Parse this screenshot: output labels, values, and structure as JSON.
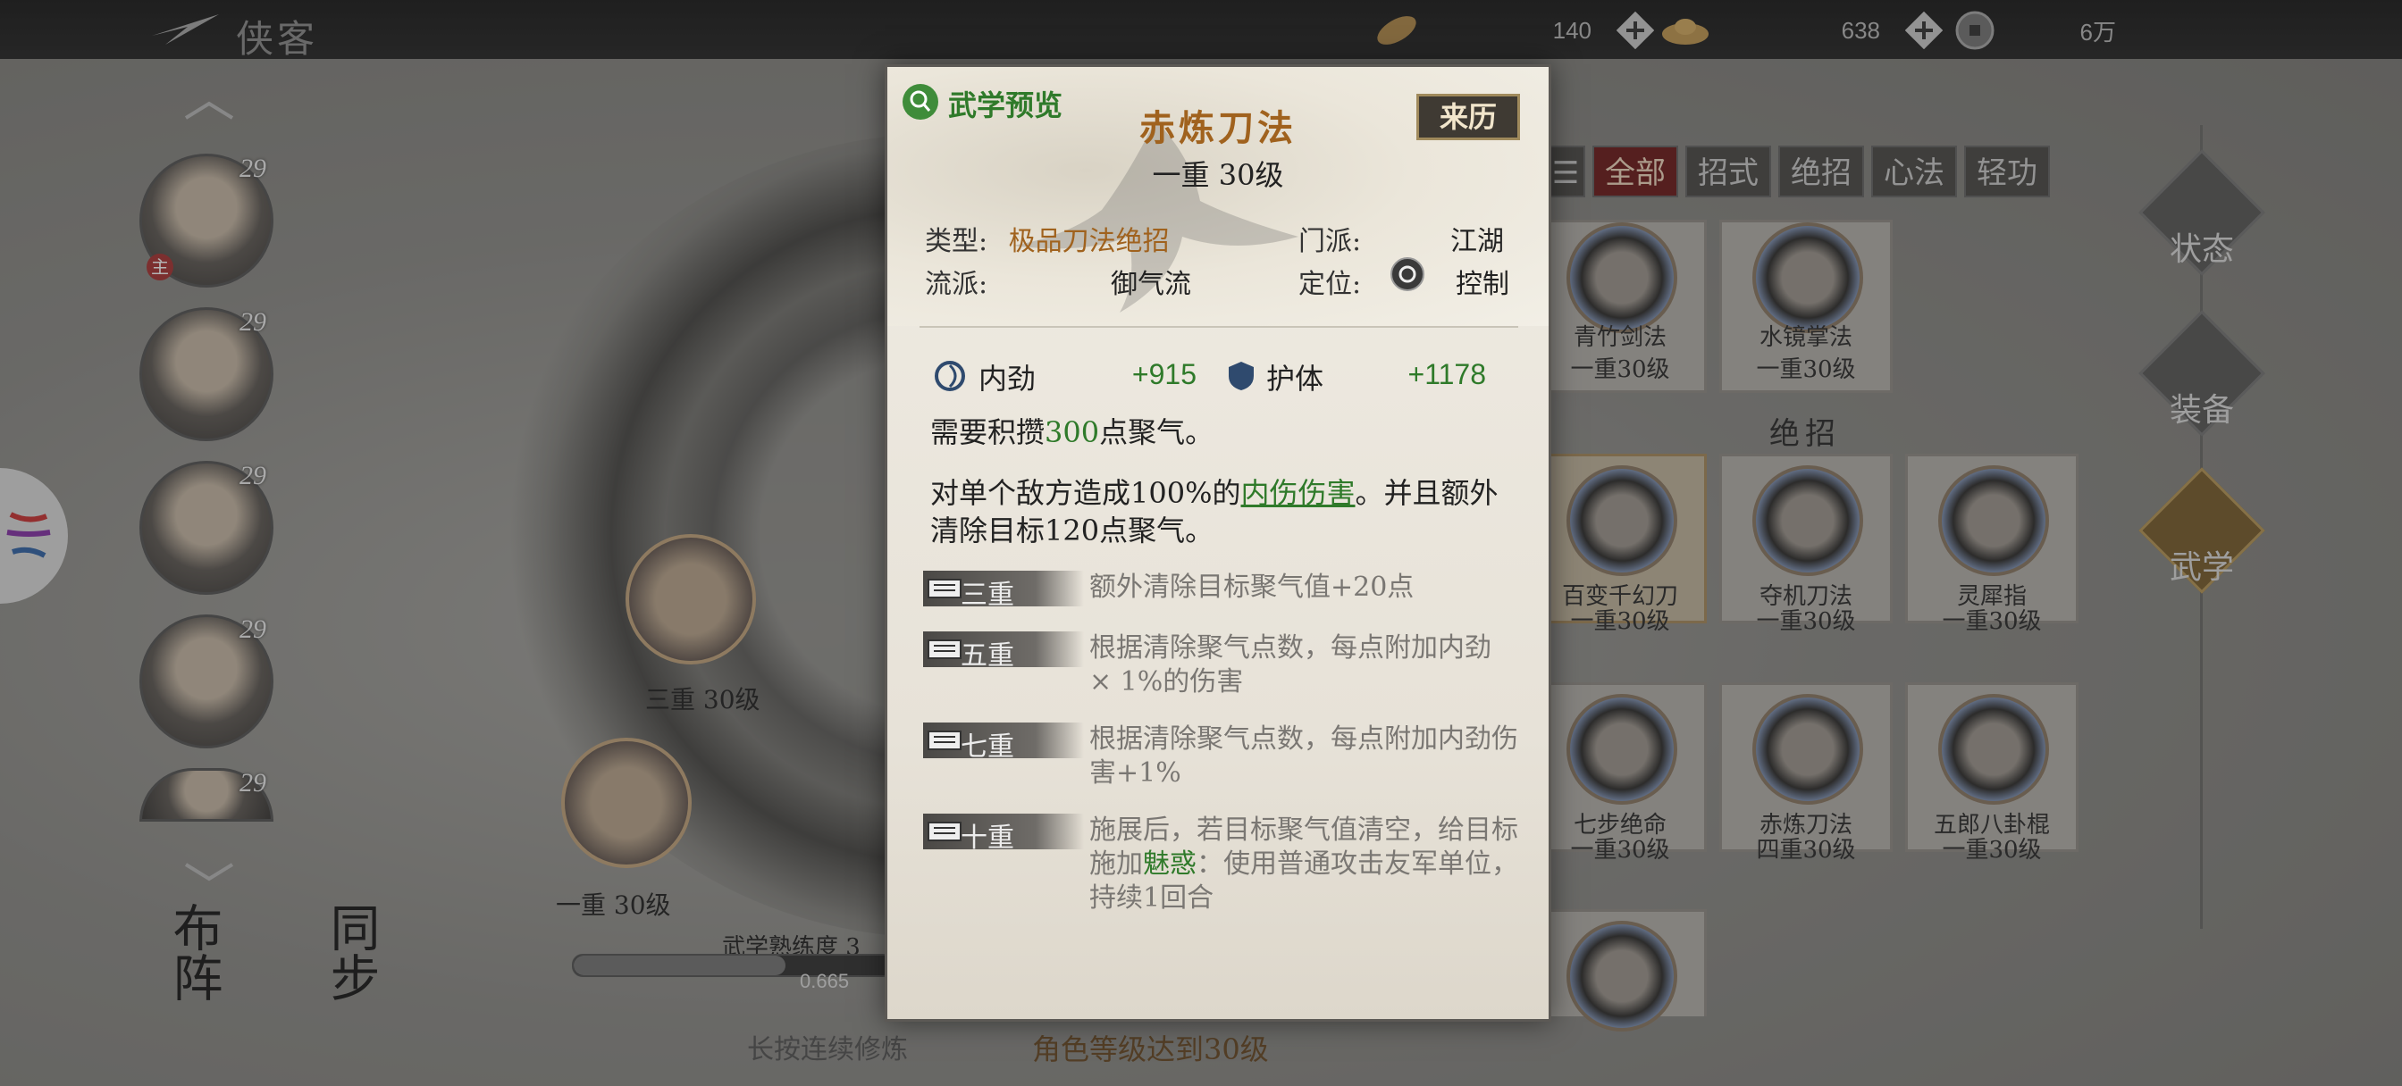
{
  "header": {
    "title": "侠客",
    "resources": [
      {
        "icon": "leaf-currency-icon",
        "value": "140"
      },
      {
        "icon": "ingot-currency-icon",
        "value": "638"
      },
      {
        "icon": "coin-currency-icon",
        "value": "6万"
      }
    ]
  },
  "characters": [
    {
      "level": "29",
      "tag": "主"
    },
    {
      "level": "29",
      "tag": ""
    },
    {
      "level": "29",
      "tag": ""
    },
    {
      "level": "29",
      "tag": ""
    },
    {
      "level": "29",
      "tag": ""
    }
  ],
  "bottom_buttons": {
    "formation": "布阵",
    "sync": "同步"
  },
  "background": {
    "node_labels": [
      "三重 30级",
      "一重 30级"
    ],
    "mastery_label": "武学熟练度 3",
    "mastery_value": "0.665",
    "mastery_progress": 0.665,
    "hold_hint": "长按连续修炼",
    "requirement": "角色等级达到30级"
  },
  "filters": [
    "全部",
    "招式",
    "绝招",
    "心法",
    "轻功"
  ],
  "skill_cards": {
    "top": [
      {
        "name": "青竹剑法",
        "level": "一重30级"
      },
      {
        "name": "水镜掌法",
        "level": "一重30级"
      }
    ],
    "section_title": "绝招",
    "ultimate": [
      {
        "name": "百变千幻刀",
        "level": "一重30级"
      },
      {
        "name": "夺机刀法",
        "level": "一重30级"
      },
      {
        "name": "灵犀指",
        "level": "一重30级"
      },
      {
        "name": "七步绝命",
        "level": "一重30级"
      },
      {
        "name": "赤炼刀法",
        "level": "四重30级"
      },
      {
        "name": "五郎八卦棍",
        "level": "一重30级"
      }
    ]
  },
  "side_menu": [
    "状态",
    "装备",
    "武学"
  ],
  "popup": {
    "preview_label": "武学预览",
    "name": "赤炼刀法",
    "level": "一重 30级",
    "origin_button": "来历",
    "type_key": "类型:",
    "type_val": "极品刀法绝招",
    "school_key": "门派:",
    "school_val": "江湖",
    "style_key": "流派:",
    "style_val": "御气流",
    "position_key": "定位:",
    "position_val": "控制",
    "stats": [
      {
        "icon": "inner-force-icon",
        "label": "内劲",
        "value": "+915"
      },
      {
        "icon": "shield-icon",
        "label": "护体",
        "value": "+1178"
      }
    ],
    "req_pre": "需要积攒",
    "req_num": "300",
    "req_post": "点聚气。",
    "effect_pre": "对单个敌方造成100%的",
    "effect_link": "内伤伤害",
    "effect_post": "。并且额外清除目标120点聚气。",
    "tiers": [
      {
        "name": "三重",
        "text": "额外清除目标聚气值+20点"
      },
      {
        "name": "五重",
        "text": "根据清除聚气点数，每点附加内劲 × 1%的伤害"
      },
      {
        "name": "七重",
        "text": "根据清除聚气点数，每点附加内劲伤害+1%"
      },
      {
        "name": "十重",
        "pre": "施展后，若目标聚气值清空，给目标施加",
        "charm": "魅惑",
        "post": "：使用普通攻击友军单位，持续1回合"
      }
    ]
  }
}
